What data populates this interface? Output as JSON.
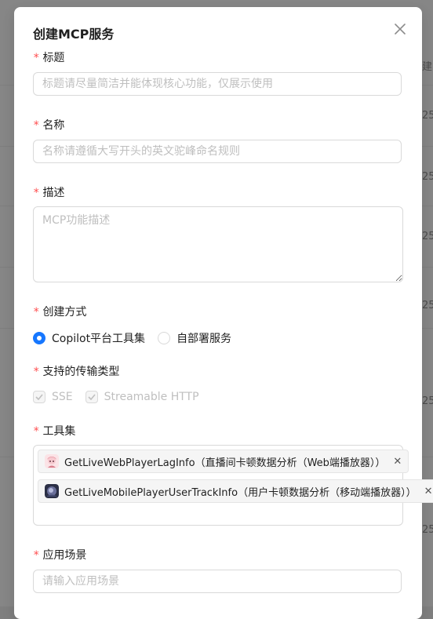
{
  "background": {
    "fragments": [
      "建",
      "25",
      "25",
      "25",
      "25",
      "25",
      "25"
    ]
  },
  "modal": {
    "title": "创建MCP服务",
    "close_icon": "close-icon"
  },
  "form": {
    "required_mark": "*",
    "title_field": {
      "label": "标题",
      "placeholder": "标题请尽量简洁并能体现核心功能，仅展示使用",
      "value": ""
    },
    "name_field": {
      "label": "名称",
      "placeholder": "名称请遵循大写开头的英文驼峰命名规则",
      "value": ""
    },
    "description_field": {
      "label": "描述",
      "placeholder": "MCP功能描述",
      "value": ""
    },
    "create_method": {
      "label": "创建方式",
      "options": [
        {
          "label": "Copilot平台工具集",
          "checked": true
        },
        {
          "label": "自部署服务",
          "checked": false
        }
      ]
    },
    "transport": {
      "label": "支持的传输类型",
      "options": [
        {
          "label": "SSE",
          "checked": true,
          "disabled": true
        },
        {
          "label": "Streamable HTTP",
          "checked": true,
          "disabled": true
        }
      ]
    },
    "toolset": {
      "label": "工具集",
      "tags": [
        {
          "label": "GetLiveWebPlayerLagInfo（直播间卡顿数据分析（Web端播放器））",
          "avatar": "anime-avatar-icon"
        },
        {
          "label": "GetLiveMobilePlayerUserTrackInfo（用户卡顿数据分析（移动端播放器））",
          "avatar": "dark-avatar-icon"
        }
      ]
    },
    "scenario_field": {
      "label": "应用场景",
      "placeholder": "请输入应用场景",
      "value": ""
    }
  },
  "colors": {
    "accent": "#1677ff",
    "required": "#ff4d4f",
    "placeholder": "#bfbfbf"
  }
}
